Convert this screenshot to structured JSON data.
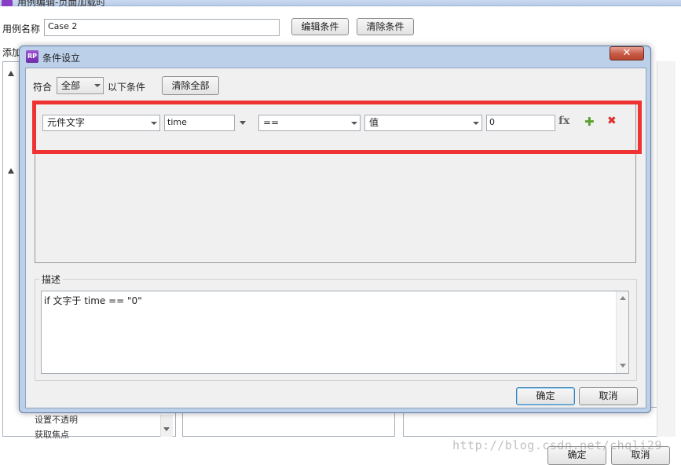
{
  "window": {
    "title": "用例编辑-页面加载时"
  },
  "case_editor": {
    "case_name_label": "用例名称",
    "case_name_value": "Case 2",
    "edit_conditions_button": "编辑条件",
    "clear_conditions_button": "清除条件",
    "add_label": "添加",
    "list_items": [
      "设置不透明",
      "获取焦点"
    ],
    "ok_button": "确定",
    "cancel_button": "取消"
  },
  "dialog": {
    "title": "条件设立",
    "icon_text": "RP",
    "close_symbol": "✕",
    "match_label": "符合",
    "match_option": "全部",
    "match_suffix": "以下条件",
    "clear_all_button": "清除全部",
    "condition_row": {
      "left_type": "元件文字",
      "widget_name": "time",
      "operator": "==",
      "right_type": "值",
      "value": "0",
      "fx_label": "fx",
      "add_symbol": "✚",
      "remove_symbol": "✖"
    },
    "description_label": "描述",
    "description_text": "if 文字于 time == \"0\"",
    "ok_button": "确定",
    "cancel_button": "取消"
  },
  "colors": {
    "highlight_red": "#ef3333",
    "add_green": "#5aa02c",
    "remove_red": "#e02b2b",
    "dialog_frame": "#bcd0ea"
  },
  "watermark": "http://blog.csdn.net/chqli29"
}
